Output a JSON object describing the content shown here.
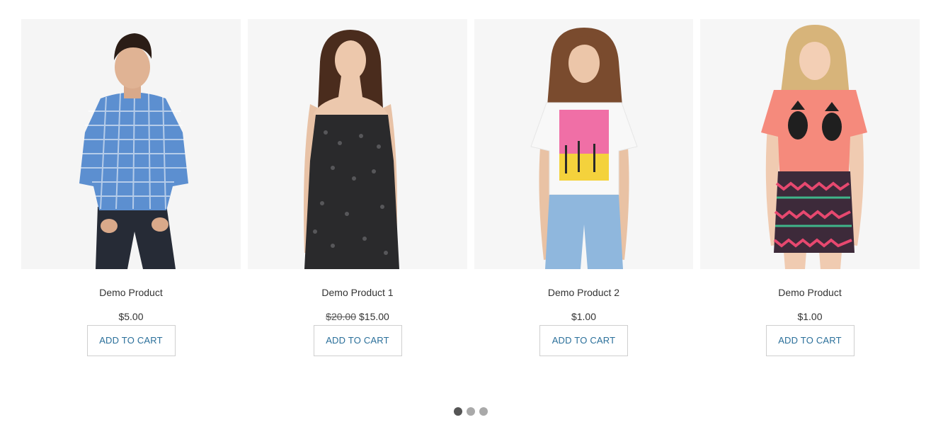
{
  "products": [
    {
      "name": "Demo Product",
      "price": "$5.00",
      "old_price": "",
      "cart_label": "ADD TO CART",
      "image_alt": "man-in-blue-checked-shirt"
    },
    {
      "name": "Demo Product 1",
      "price": "$15.00",
      "old_price": "$20.00",
      "cart_label": "ADD TO CART",
      "image_alt": "woman-in-black-sequin-dress"
    },
    {
      "name": "Demo Product 2",
      "price": "$1.00",
      "old_price": "",
      "cart_label": "ADD TO CART",
      "image_alt": "woman-in-palm-springs-tshirt"
    },
    {
      "name": "Demo Product",
      "price": "$1.00",
      "old_price": "",
      "cart_label": "ADD TO CART",
      "image_alt": "woman-in-coral-top-and-patterned-skirt"
    }
  ],
  "pagination": {
    "pages": 3,
    "active": 1
  },
  "colors": {
    "link": "#2a6f9a",
    "dot": "#a9a9a9",
    "dot_active": "#555555",
    "photo_bg": "#f4f4f4"
  }
}
